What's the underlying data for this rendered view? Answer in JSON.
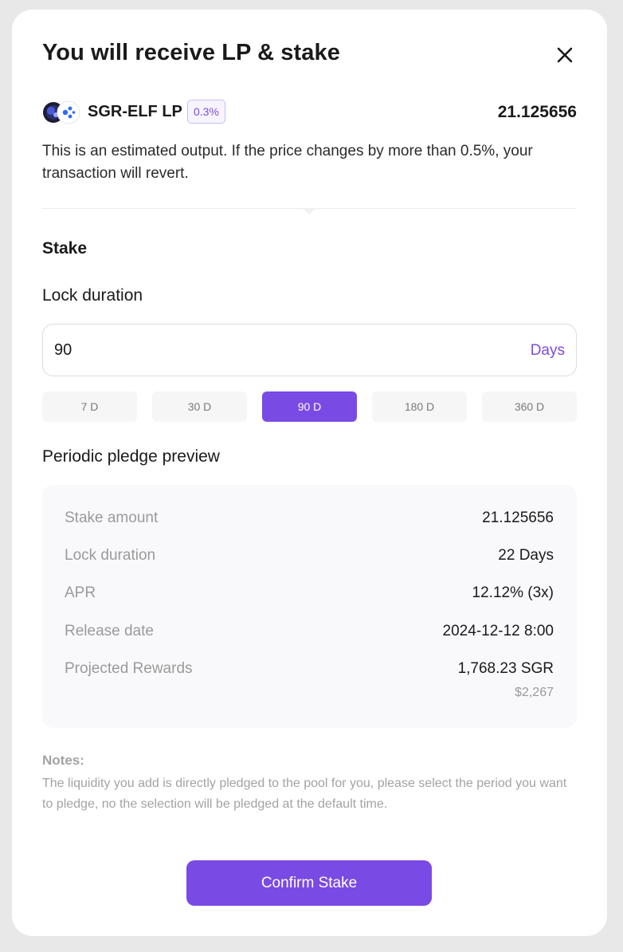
{
  "modal": {
    "title": "You will receive LP & stake"
  },
  "lp": {
    "name": "SGR-ELF LP",
    "fee": "0.3%",
    "amount": "21.125656",
    "estimate_text": "This is an estimated output. If the price changes by more than 0.5%, your transaction will revert."
  },
  "stake": {
    "section_title": "Stake",
    "lock_duration_label": "Lock duration",
    "input_value": "90",
    "input_unit": "Days",
    "chips": [
      "7 D",
      "30 D",
      "90 D",
      "180 D",
      "360 D"
    ],
    "active_chip": "90 D"
  },
  "preview": {
    "title": "Periodic pledge preview",
    "rows": [
      {
        "label": "Stake amount",
        "value": "21.125656"
      },
      {
        "label": "Lock duration",
        "value": "22 Days"
      },
      {
        "label": "APR",
        "value": "12.12% (3x)"
      },
      {
        "label": "Release date",
        "value": "2024-12-12 8:00"
      },
      {
        "label": "Projected Rewards",
        "value": "1,768.23 SGR",
        "sub": "$2,267"
      }
    ]
  },
  "notes": {
    "title": "Notes:",
    "text": "The liquidity you add is directly pledged to the pool for you, please select the period you want to pledge, no the selection will be pledged at the default time."
  },
  "actions": {
    "confirm_label": "Confirm Stake"
  },
  "colors": {
    "accent": "#7a4ae4",
    "muted": "#9a9a9a",
    "background": "#e8e8e8"
  },
  "icons": {
    "close": "close-icon",
    "token_a": "sgr-token-icon",
    "token_b": "elf-token-icon"
  }
}
